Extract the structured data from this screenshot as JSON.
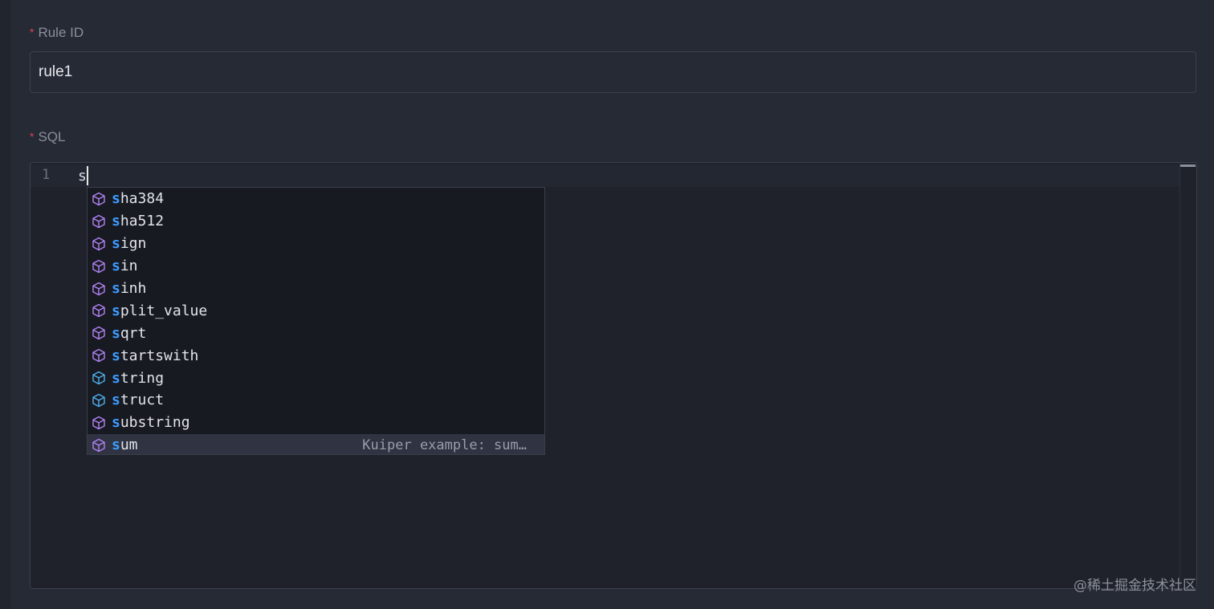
{
  "form": {
    "rule_id_label": "Rule ID",
    "rule_id_value": "rule1",
    "sql_label": "SQL",
    "required_mark": "*"
  },
  "editor": {
    "line_number": "1",
    "code": "s"
  },
  "suggestions": [
    {
      "match": "s",
      "rest": "ha384",
      "icon": "function-cube-icon",
      "color": "#b283f5"
    },
    {
      "match": "s",
      "rest": "ha512",
      "icon": "function-cube-icon",
      "color": "#b283f5"
    },
    {
      "match": "s",
      "rest": "ign",
      "icon": "function-cube-icon",
      "color": "#b283f5"
    },
    {
      "match": "s",
      "rest": "in",
      "icon": "function-cube-icon",
      "color": "#b283f5"
    },
    {
      "match": "s",
      "rest": "inh",
      "icon": "function-cube-icon",
      "color": "#b283f5"
    },
    {
      "match": "s",
      "rest": "plit_value",
      "icon": "function-cube-icon",
      "color": "#b283f5"
    },
    {
      "match": "s",
      "rest": "qrt",
      "icon": "function-cube-icon",
      "color": "#b283f5"
    },
    {
      "match": "s",
      "rest": "tartswith",
      "icon": "function-cube-icon",
      "color": "#b283f5"
    },
    {
      "match": "s",
      "rest": "tring",
      "icon": "type-cube-icon",
      "color": "#4fb0ee"
    },
    {
      "match": "s",
      "rest": "truct",
      "icon": "type-cube-icon",
      "color": "#4fb0ee"
    },
    {
      "match": "s",
      "rest": "ubstring",
      "icon": "function-cube-icon",
      "color": "#b283f5"
    },
    {
      "match": "s",
      "rest": "um",
      "icon": "function-cube-icon",
      "color": "#b283f5",
      "detail": "Kuiper example: sum…",
      "selected": true
    }
  ],
  "colors": {
    "match_highlight": "#3d9bff",
    "required": "#d9425b"
  },
  "watermark": "@稀土掘金技术社区"
}
